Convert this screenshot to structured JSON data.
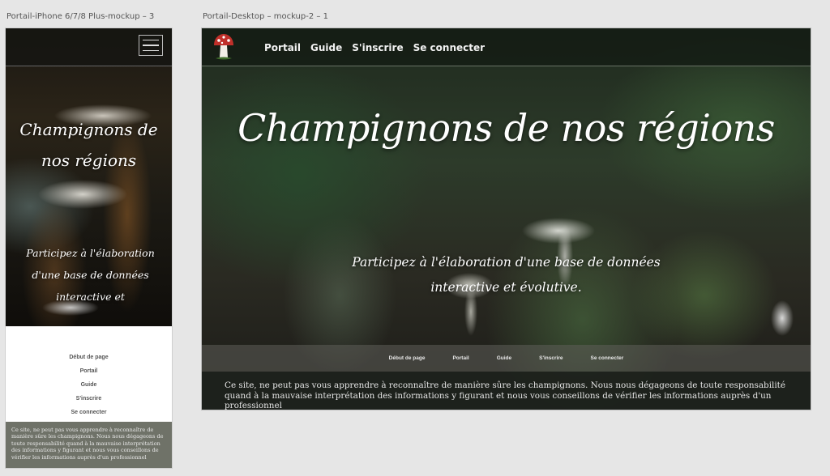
{
  "artboards": {
    "mobile_label": "Portail-iPhone 6/7/8 Plus-mockup – 3",
    "desktop_label": "Portail-Desktop – mockup-2 – 1"
  },
  "mobile": {
    "menu_icon": "hamburger-menu-icon",
    "title": "Champignons de nos régions",
    "subtitle": "Participez à l'élaboration d'une base de données interactive et",
    "footer_nav": [
      "Début de page",
      "Portail",
      "Guide",
      "S'inscrire",
      "Se connecter"
    ],
    "disclaimer": "Ce site, ne peut pas vous apprendre à reconnaître de manière sûre les champignons. Nous nous dégageons de toute responsabilité quand à la mauvaise interprétation des informations y figurant et nous vous conseillons de vérifier les informations auprès d'un professionnel"
  },
  "desktop": {
    "logo_icon": "mushroom-logo-icon",
    "nav": [
      "Portail",
      "Guide",
      "S'inscrire",
      "Se connecter"
    ],
    "title": "Champignons de nos régions",
    "subtitle": "Participez à l'élaboration d'une base de données interactive et évolutive.",
    "footer_nav": [
      "Début de page",
      "Portail",
      "Guide",
      "S'inscrire",
      "Se connecter"
    ],
    "disclaimer": "Ce site, ne peut pas vous apprendre à reconnaître de manière sûre les champignons. Nous nous dégageons de toute responsabilité quand à la mauvaise interprétation des informations y figurant et nous vous conseillons de vérifier les informations auprès d'un professionnel"
  },
  "colors": {
    "mobile_disclaimer_bg": "#6f7268",
    "desktop_header_bg": "#141c14",
    "logo_cap": "#c0302a"
  }
}
